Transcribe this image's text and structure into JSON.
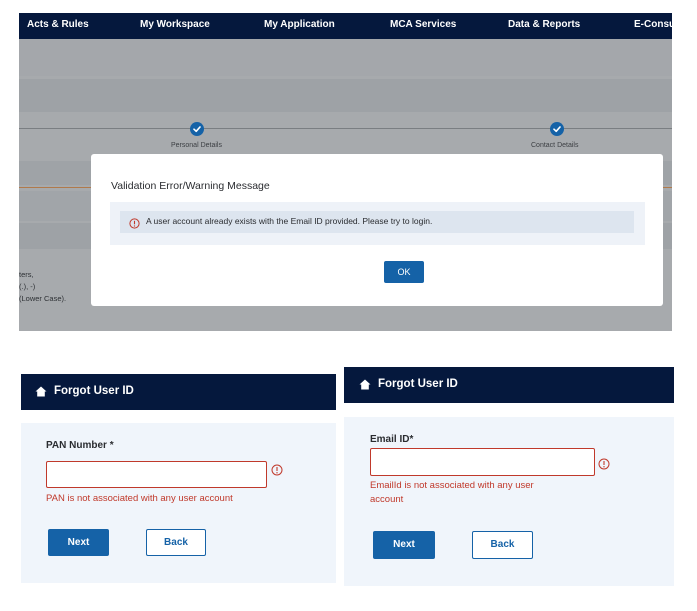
{
  "nav": {
    "items": [
      "Acts & Rules",
      "My Workspace",
      "My Application",
      "MCA Services",
      "Data & Reports",
      "E-Consu"
    ]
  },
  "steps": {
    "personal": "Personal Details",
    "contact": "Contact Details"
  },
  "background_text": {
    "line1": "ters,",
    "line2": "(.), -)",
    "line3": "(Lower Case)."
  },
  "modal": {
    "title": "Validation Error/Warning Message",
    "message": "A user account already exists with the Email ID provided. Please try to login.",
    "ok_label": "OK"
  },
  "forgot_pan": {
    "header": "Forgot User ID",
    "label": "PAN Number *",
    "value": "",
    "error": "PAN is not associated with any user account",
    "next_label": "Next",
    "back_label": "Back"
  },
  "forgot_email": {
    "header": "Forgot User ID",
    "label": "Email ID*",
    "value": "",
    "error_line1": "EmailId is not associated with any user",
    "error_line2": "account",
    "next_label": "Next",
    "back_label": "Back"
  },
  "colors": {
    "navy": "#05183d",
    "primary_blue": "#1562a7",
    "error_red": "#c0392b",
    "panel_bg": "#f0f5fb",
    "overlay_gray": "#a7aaad"
  }
}
